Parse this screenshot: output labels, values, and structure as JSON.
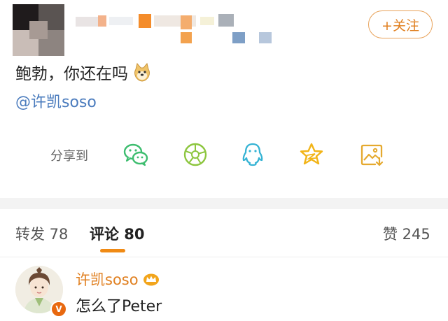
{
  "header": {
    "follow_label": "+关注"
  },
  "post": {
    "text": "鲍勃，你还在吗",
    "mention": "@许凯soso"
  },
  "share": {
    "label": "分享到",
    "icons": [
      "wechat-icon",
      "moments-icon",
      "qq-icon",
      "qzone-star-icon",
      "save-image-icon"
    ],
    "accent": "#3dbd6f"
  },
  "tabs": {
    "repost": "转发 78",
    "comments": "评论 80",
    "likes": "赞 245"
  },
  "comment": {
    "author": "许凯soso",
    "badge": "V",
    "text": "怎么了Peter"
  },
  "colors": {
    "accent": "#e07f1f",
    "link": "#4a7bbd",
    "tab_indicator": "#f08a14"
  }
}
